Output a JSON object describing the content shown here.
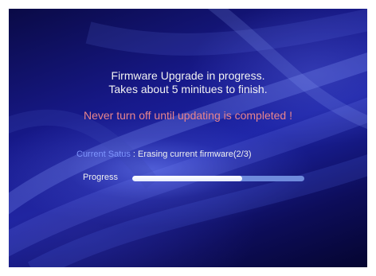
{
  "message": {
    "title_line1": "Firmware Upgrade in progress.",
    "title_line2": "Takes about 5 minitues to finish.",
    "warning": "Never turn off until updating is completed !"
  },
  "status": {
    "label": "Current Satus",
    "separator": " : ",
    "value": "Erasing current firmware(2/3)"
  },
  "progress": {
    "label": "Progress",
    "fraction": 0.64,
    "fill_color": "#ffffff",
    "track_color": "#6f8bdc"
  },
  "colors": {
    "background": "#1c23a6",
    "warning_text": "#e8848c",
    "status_label": "#7f96ff"
  }
}
